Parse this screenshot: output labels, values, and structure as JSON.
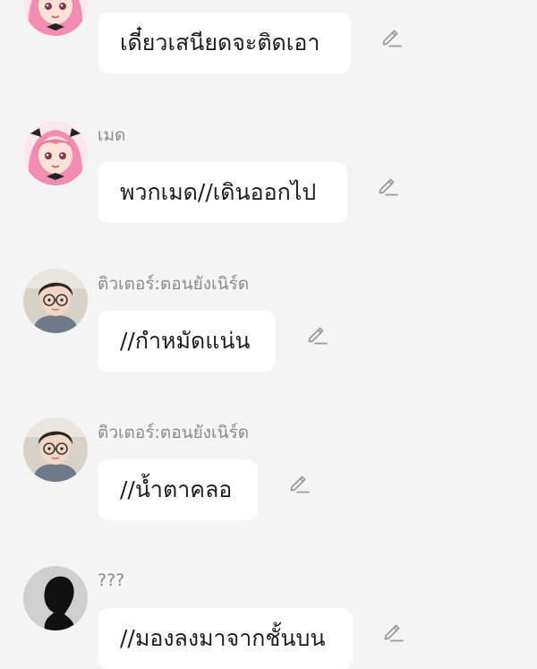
{
  "messages": [
    {
      "sender": "",
      "avatar": "anime-girl-avatar",
      "text": "เดี๋ยวเสนียดจะติดเอา",
      "edit_icon": "pencil-icon"
    },
    {
      "sender": "เมด",
      "avatar": "anime-girl-avatar",
      "text": "พวกเมด//เดินออกไป",
      "edit_icon": "pencil-icon"
    },
    {
      "sender": "ติวเตอร์:ตอนยังเนิร์ด",
      "avatar": "glasses-boy-avatar",
      "text": "//กำหมัดแน่น",
      "edit_icon": "pencil-icon"
    },
    {
      "sender": "ติวเตอร์:ตอนยังเนิร์ด",
      "avatar": "glasses-boy-avatar",
      "text": "//น้ำตาคลอ",
      "edit_icon": "pencil-icon"
    },
    {
      "sender": "???",
      "avatar": "silhouette-avatar",
      "text": "//มองลงมาจากชั้นบน",
      "edit_icon": "pencil-icon"
    }
  ],
  "colors": {
    "background": "#f4f4f4",
    "bubble": "#ffffff",
    "sender_text": "#8c8c8c",
    "message_text": "#1e1e1e",
    "icon": "#9a9a9a"
  }
}
